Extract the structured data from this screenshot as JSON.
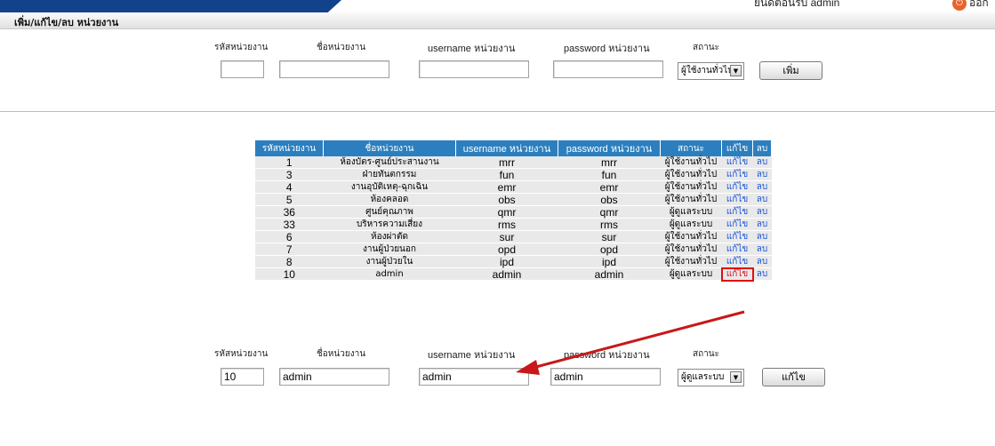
{
  "header": {
    "welcome": "ยินดีต้อนรับ admin",
    "logout": "ออก"
  },
  "section_title": "เพิ่ม/แก้ไข/ลบ หน่วยงาน",
  "add_form": {
    "labels": {
      "code": "รหัสหน่วยงาน",
      "name": "ชื่อหน่วยงาน",
      "username": "username หน่วยงาน",
      "password": "password หน่วยงาน",
      "status": "สถานะ"
    },
    "values": {
      "code": "",
      "name": "",
      "username": "",
      "password": ""
    },
    "status_value": "ผู้ใช้งานทั่วไป",
    "submit_label": "เพิ่ม"
  },
  "table": {
    "headers": {
      "code": "รหัสหน่วยงาน",
      "name": "ชื่อหน่วยงาน",
      "username": "username หน่วยงาน",
      "password": "password หน่วยงาน",
      "status": "สถานะ",
      "edit": "แก้ไข",
      "del": "ลบ"
    },
    "rows": [
      {
        "code": "1",
        "name": "ห้องบัตร-ศูนย์ประสานงาน",
        "username": "mrr",
        "password": "mrr",
        "status": "ผู้ใช้งานทั่วไป",
        "edit": "แก้ไข",
        "del": "ลบ"
      },
      {
        "code": "3",
        "name": "ฝ่ายทันตกรรม",
        "username": "fun",
        "password": "fun",
        "status": "ผู้ใช้งานทั่วไป",
        "edit": "แก้ไข",
        "del": "ลบ"
      },
      {
        "code": "4",
        "name": "งานอุบัติเหตุ-ฉุกเฉิน",
        "username": "emr",
        "password": "emr",
        "status": "ผู้ใช้งานทั่วไป",
        "edit": "แก้ไข",
        "del": "ลบ"
      },
      {
        "code": "5",
        "name": "ห้องคลอด",
        "username": "obs",
        "password": "obs",
        "status": "ผู้ใช้งานทั่วไป",
        "edit": "แก้ไข",
        "del": "ลบ"
      },
      {
        "code": "36",
        "name": "ศูนย์คุณภาพ",
        "username": "qmr",
        "password": "qmr",
        "status": "ผู้ดูแลระบบ",
        "edit": "แก้ไข",
        "del": "ลบ"
      },
      {
        "code": "33",
        "name": "บริหารความเสี่ยง",
        "username": "rms",
        "password": "rms",
        "status": "ผู้ดูแลระบบ",
        "edit": "แก้ไข",
        "del": "ลบ"
      },
      {
        "code": "6",
        "name": "ห้องผ่าตัด",
        "username": "sur",
        "password": "sur",
        "status": "ผู้ใช้งานทั่วไป",
        "edit": "แก้ไข",
        "del": "ลบ"
      },
      {
        "code": "7",
        "name": "งานผู้ป่วยนอก",
        "username": "opd",
        "password": "opd",
        "status": "ผู้ใช้งานทั่วไป",
        "edit": "แก้ไข",
        "del": "ลบ"
      },
      {
        "code": "8",
        "name": "งานผู้ป่วยใน",
        "username": "ipd",
        "password": "ipd",
        "status": "ผู้ใช้งานทั่วไป",
        "edit": "แก้ไข",
        "del": "ลบ"
      },
      {
        "code": "10",
        "name": "admin",
        "username": "admin",
        "password": "admin",
        "status": "ผู้ดูแลระบบ",
        "edit": "แก้ไข",
        "del": "ลบ"
      }
    ]
  },
  "edit_form": {
    "labels": {
      "code": "รหัสหน่วยงาน",
      "name": "ชื่อหน่วยงาน",
      "username": "username หน่วยงาน",
      "password": "password หน่วยงาน",
      "status": "สถานะ"
    },
    "values": {
      "code": "10",
      "name": "admin",
      "username": "admin",
      "password": "admin"
    },
    "status_value": "ผู้ดูแลระบบ",
    "submit_label": "แก้ไข"
  },
  "colors": {
    "header_blue": "#13428c",
    "table_header": "#2c7fbf",
    "link": "#1a55d8",
    "annotation_red": "#e01010"
  }
}
